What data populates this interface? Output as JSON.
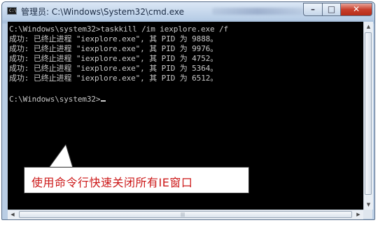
{
  "window": {
    "title": "管理员: C:\\Windows\\System32\\cmd.exe",
    "controls": {
      "minimize": "–",
      "maximize": "□",
      "close": "✕"
    },
    "title_icon_text": "C:\\"
  },
  "console": {
    "lines": [
      "C:\\Windows\\system32>taskkill /im iexplore.exe /f",
      "成功: 已终止进程 \"iexplore.exe\", 其 PID 为 9888。",
      "成功: 已终止进程 \"iexplore.exe\", 其 PID 为 9976。",
      "成功: 已终止进程 \"iexplore.exe\", 其 PID 为 4752。",
      "成功: 已终止进程 \"iexplore.exe\", 其 PID 为 5364。",
      "成功: 已终止进程 \"iexplore.exe\", 其 PID 为 6512。",
      "",
      "C:\\Windows\\system32>"
    ]
  },
  "callout": {
    "text": "使用命令行快速关闭所有IE窗口",
    "text_color": "#cc1818"
  },
  "scrollbars": {
    "up_arrow": "▲",
    "down_arrow": "▼",
    "left_arrow": "◀",
    "right_arrow": "▶",
    "grip": "|||"
  },
  "colors": {
    "console_bg": "#000000",
    "console_text": "#c8c8c8",
    "close_button": "#c8402d"
  }
}
